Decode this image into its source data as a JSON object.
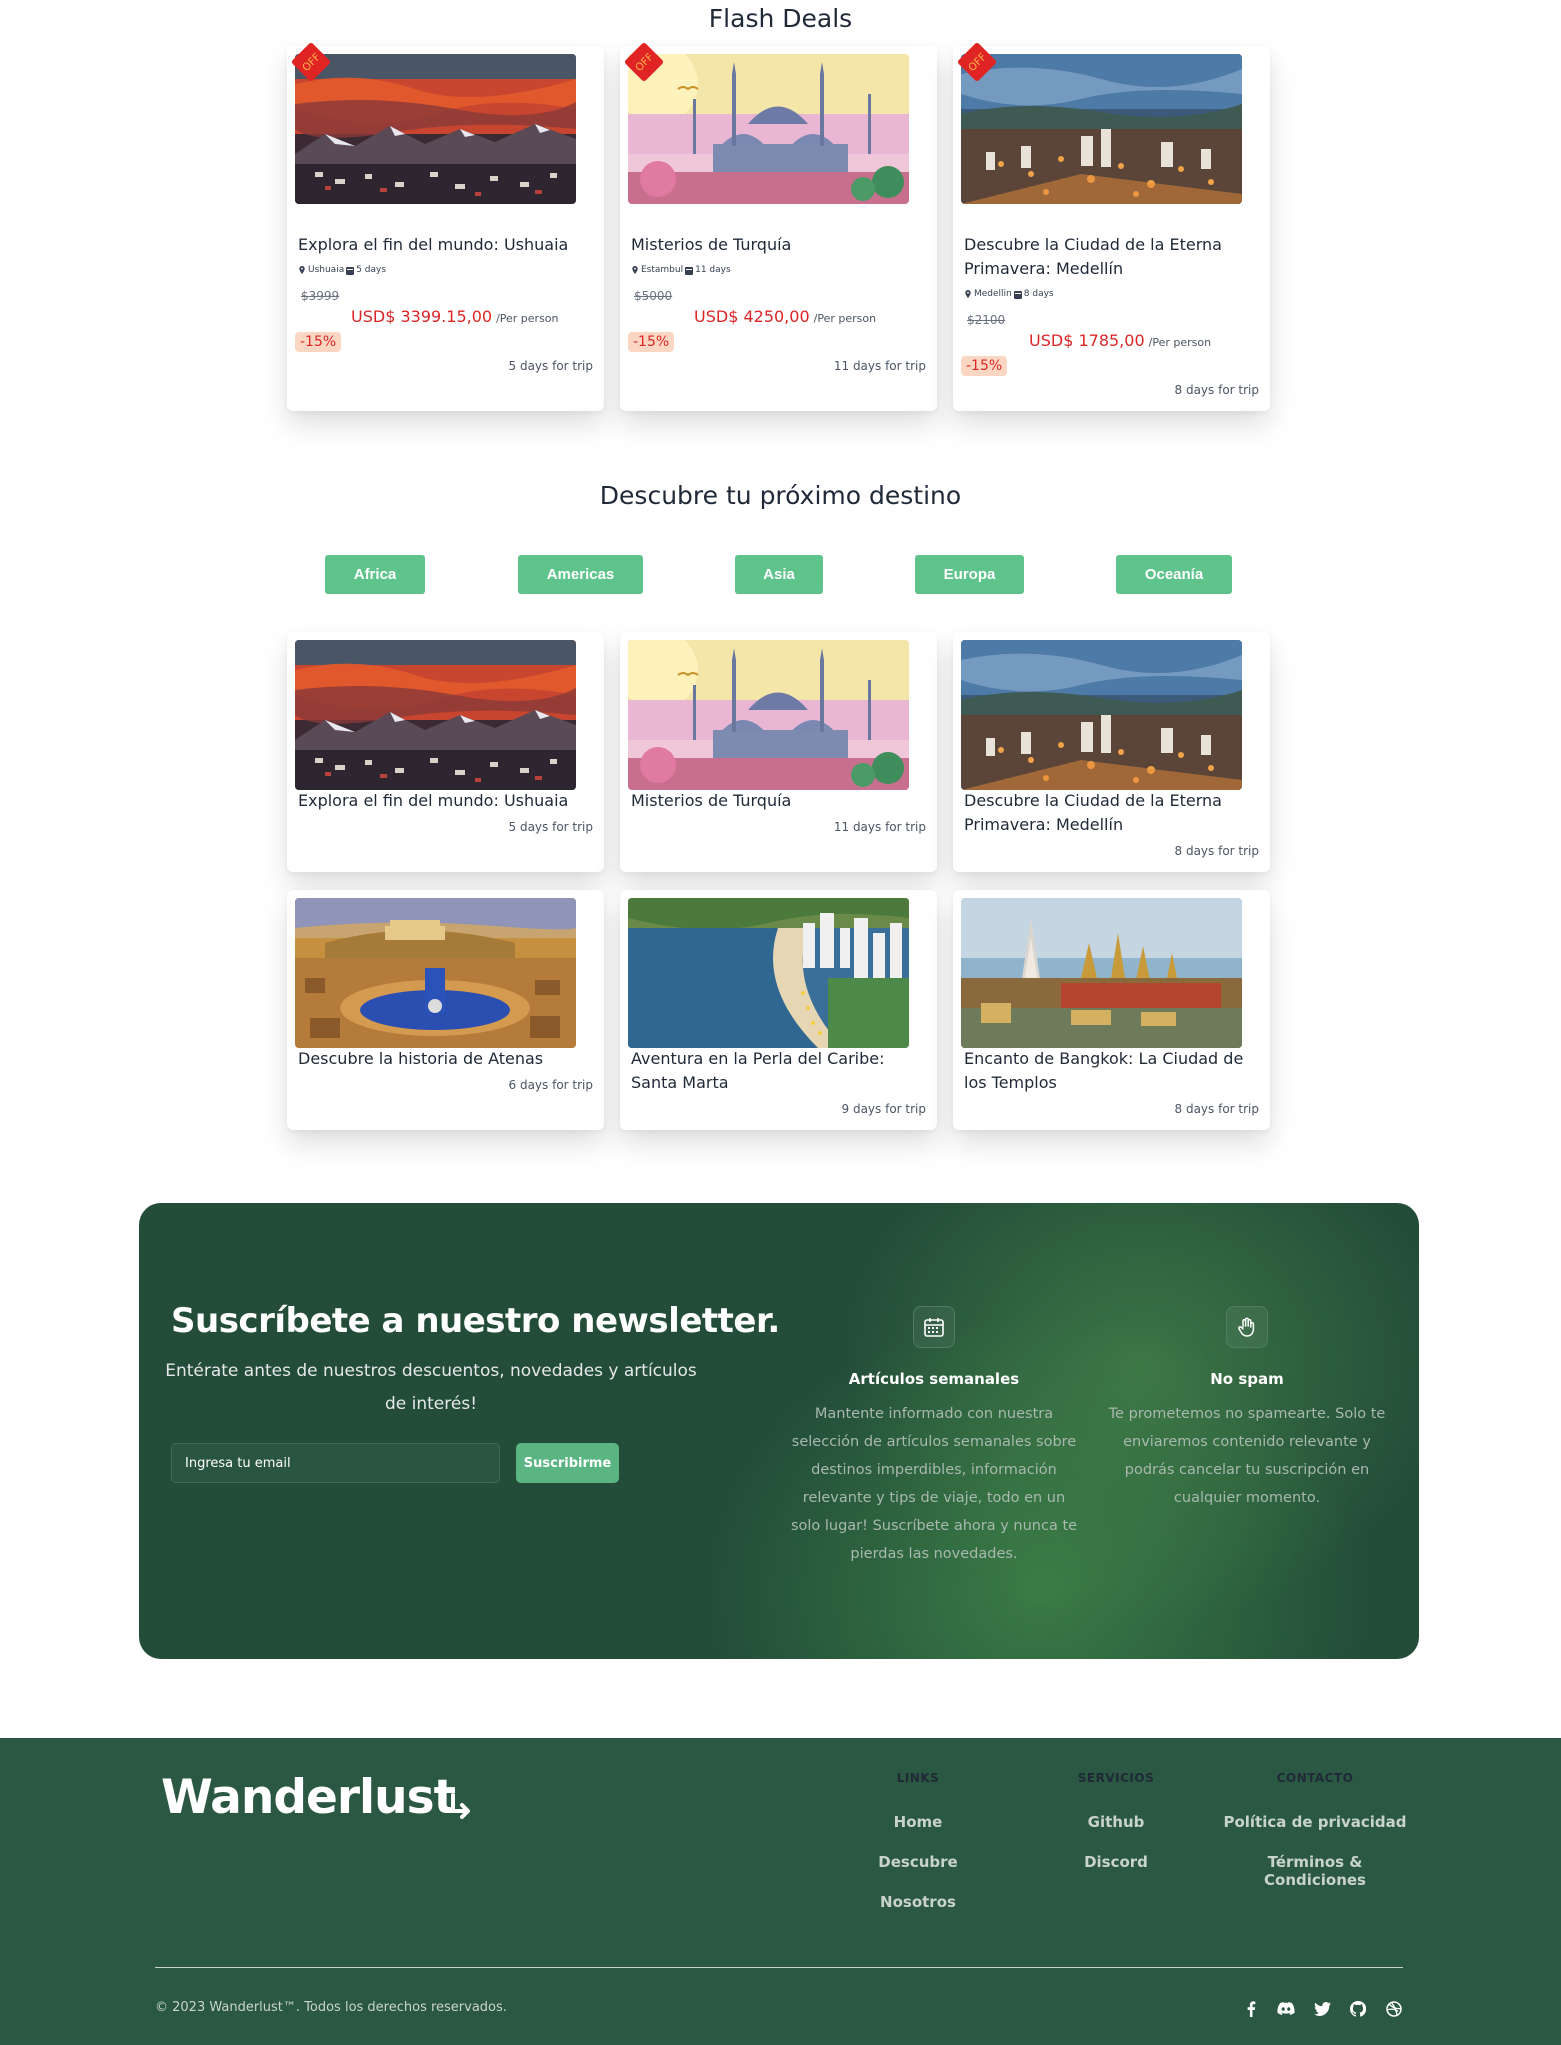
{
  "flash": {
    "title": "Flash Deals",
    "off_label": "OFF",
    "cards": [
      {
        "title": "Explora el fin del mundo: Ushuaia",
        "location": "Ushuaia",
        "duration": "5 days",
        "old_price": "$3999",
        "price": "USD$ 3399.15,00",
        "per": "/Per person",
        "discount": "-15%",
        "days": "5 days for trip"
      },
      {
        "title": "Misterios de Turquía",
        "location": "Estambul",
        "duration": "11 days",
        "old_price": "$5000",
        "price": "USD$ 4250,00",
        "per": "/Per person",
        "discount": "-15%",
        "days": "11 days for trip"
      },
      {
        "title": "Descubre la Ciudad de la Eterna Primavera: Medellín",
        "location": "Medellin",
        "duration": "8 days",
        "old_price": "$2100",
        "price": "USD$ 1785,00",
        "per": "/Per person",
        "discount": "-15%",
        "days": "8 days for trip"
      }
    ]
  },
  "destinations": {
    "title": "Descubre tu próximo destino",
    "regions": [
      "Africa",
      "Americas",
      "Asia",
      "Europa",
      "Oceanía"
    ],
    "cards": [
      {
        "title": "Explora el fin del mundo: Ushuaia",
        "days": "5 days for trip"
      },
      {
        "title": "Misterios de Turquía",
        "days": "11 days for trip"
      },
      {
        "title": "Descubre la Ciudad de la Eterna Primavera: Medellín",
        "days": "8 days for trip"
      },
      {
        "title": "Descubre la historia de Atenas",
        "days": "6 days for trip"
      },
      {
        "title": "Aventura en la Perla del Caribe: Santa Marta",
        "days": "9 days for trip"
      },
      {
        "title": "Encanto de Bangkok: La Ciudad de los Templos",
        "days": "8 days for trip"
      }
    ]
  },
  "newsletter": {
    "title": "Suscríbete a nuestro newsletter.",
    "subtitle": "Entérate antes de nuestros descuentos, novedades y artículos de interés!",
    "input_placeholder": "Ingresa tu email",
    "button": "Suscribirme",
    "features": [
      {
        "icon": "calendar-icon",
        "title": "Artículos semanales",
        "text": "Mantente informado con nuestra selección de artículos semanales sobre destinos imperdibles, información relevante y tips de viaje, todo en un solo lugar! Suscríbete ahora y nunca te pierdas las novedades."
      },
      {
        "icon": "hand-icon",
        "title": "No spam",
        "text": "Te prometemos no spamearte. Solo te enviaremos contenido relevante y podrás cancelar tu suscripción en cualquier momento."
      }
    ]
  },
  "footer": {
    "logo": "Wanderlust",
    "columns": [
      {
        "heading": "LINKS",
        "links": [
          "Home",
          "Descubre",
          "Nosotros"
        ]
      },
      {
        "heading": "SERVICIOS",
        "links": [
          "Github",
          "Discord"
        ]
      },
      {
        "heading": "CONTACTO",
        "links": [
          "Política de privacidad",
          "Términos & Condiciones"
        ]
      }
    ],
    "copyright": "© 2023 Wanderlust™. Todos los derechos reservados.",
    "social": [
      "facebook-icon",
      "discord-icon",
      "twitter-icon",
      "github-icon",
      "dribbble-icon"
    ]
  },
  "colors": {
    "accent": "#5fc48b",
    "price": "#dc2626",
    "newsletter_bg": "#234d39",
    "footer_bg": "#2b5842"
  }
}
